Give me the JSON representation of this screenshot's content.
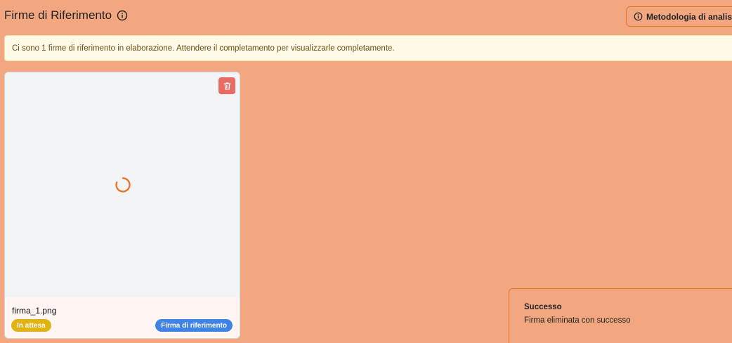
{
  "header": {
    "title": "Firme di Riferimento",
    "info_icon": "info-circle-icon"
  },
  "toolbar": {
    "methodology_label": "Metodologia di analisi",
    "methodology_icon": "info-circle-icon"
  },
  "alert": {
    "message": "Ci sono 1 firme di riferimento in elaborazione. Attendere il completamento per visualizzarle completamente."
  },
  "signatures": [
    {
      "file_name": "firma_1.png",
      "status": "In attesa",
      "type": "Firma di riferimento",
      "preview_state": "loading-spinner-icon",
      "delete_icon": "trash-icon"
    }
  ],
  "toast": {
    "title": "Successo",
    "message": "Firma eliminata con successo"
  },
  "colors": {
    "background": "#f2a781",
    "accent": "#e8762a",
    "alert_bg": "#fefae7",
    "pending_badge": "#e2b112",
    "reference_badge": "#3f83e6",
    "delete_button": "#ea6a64"
  }
}
